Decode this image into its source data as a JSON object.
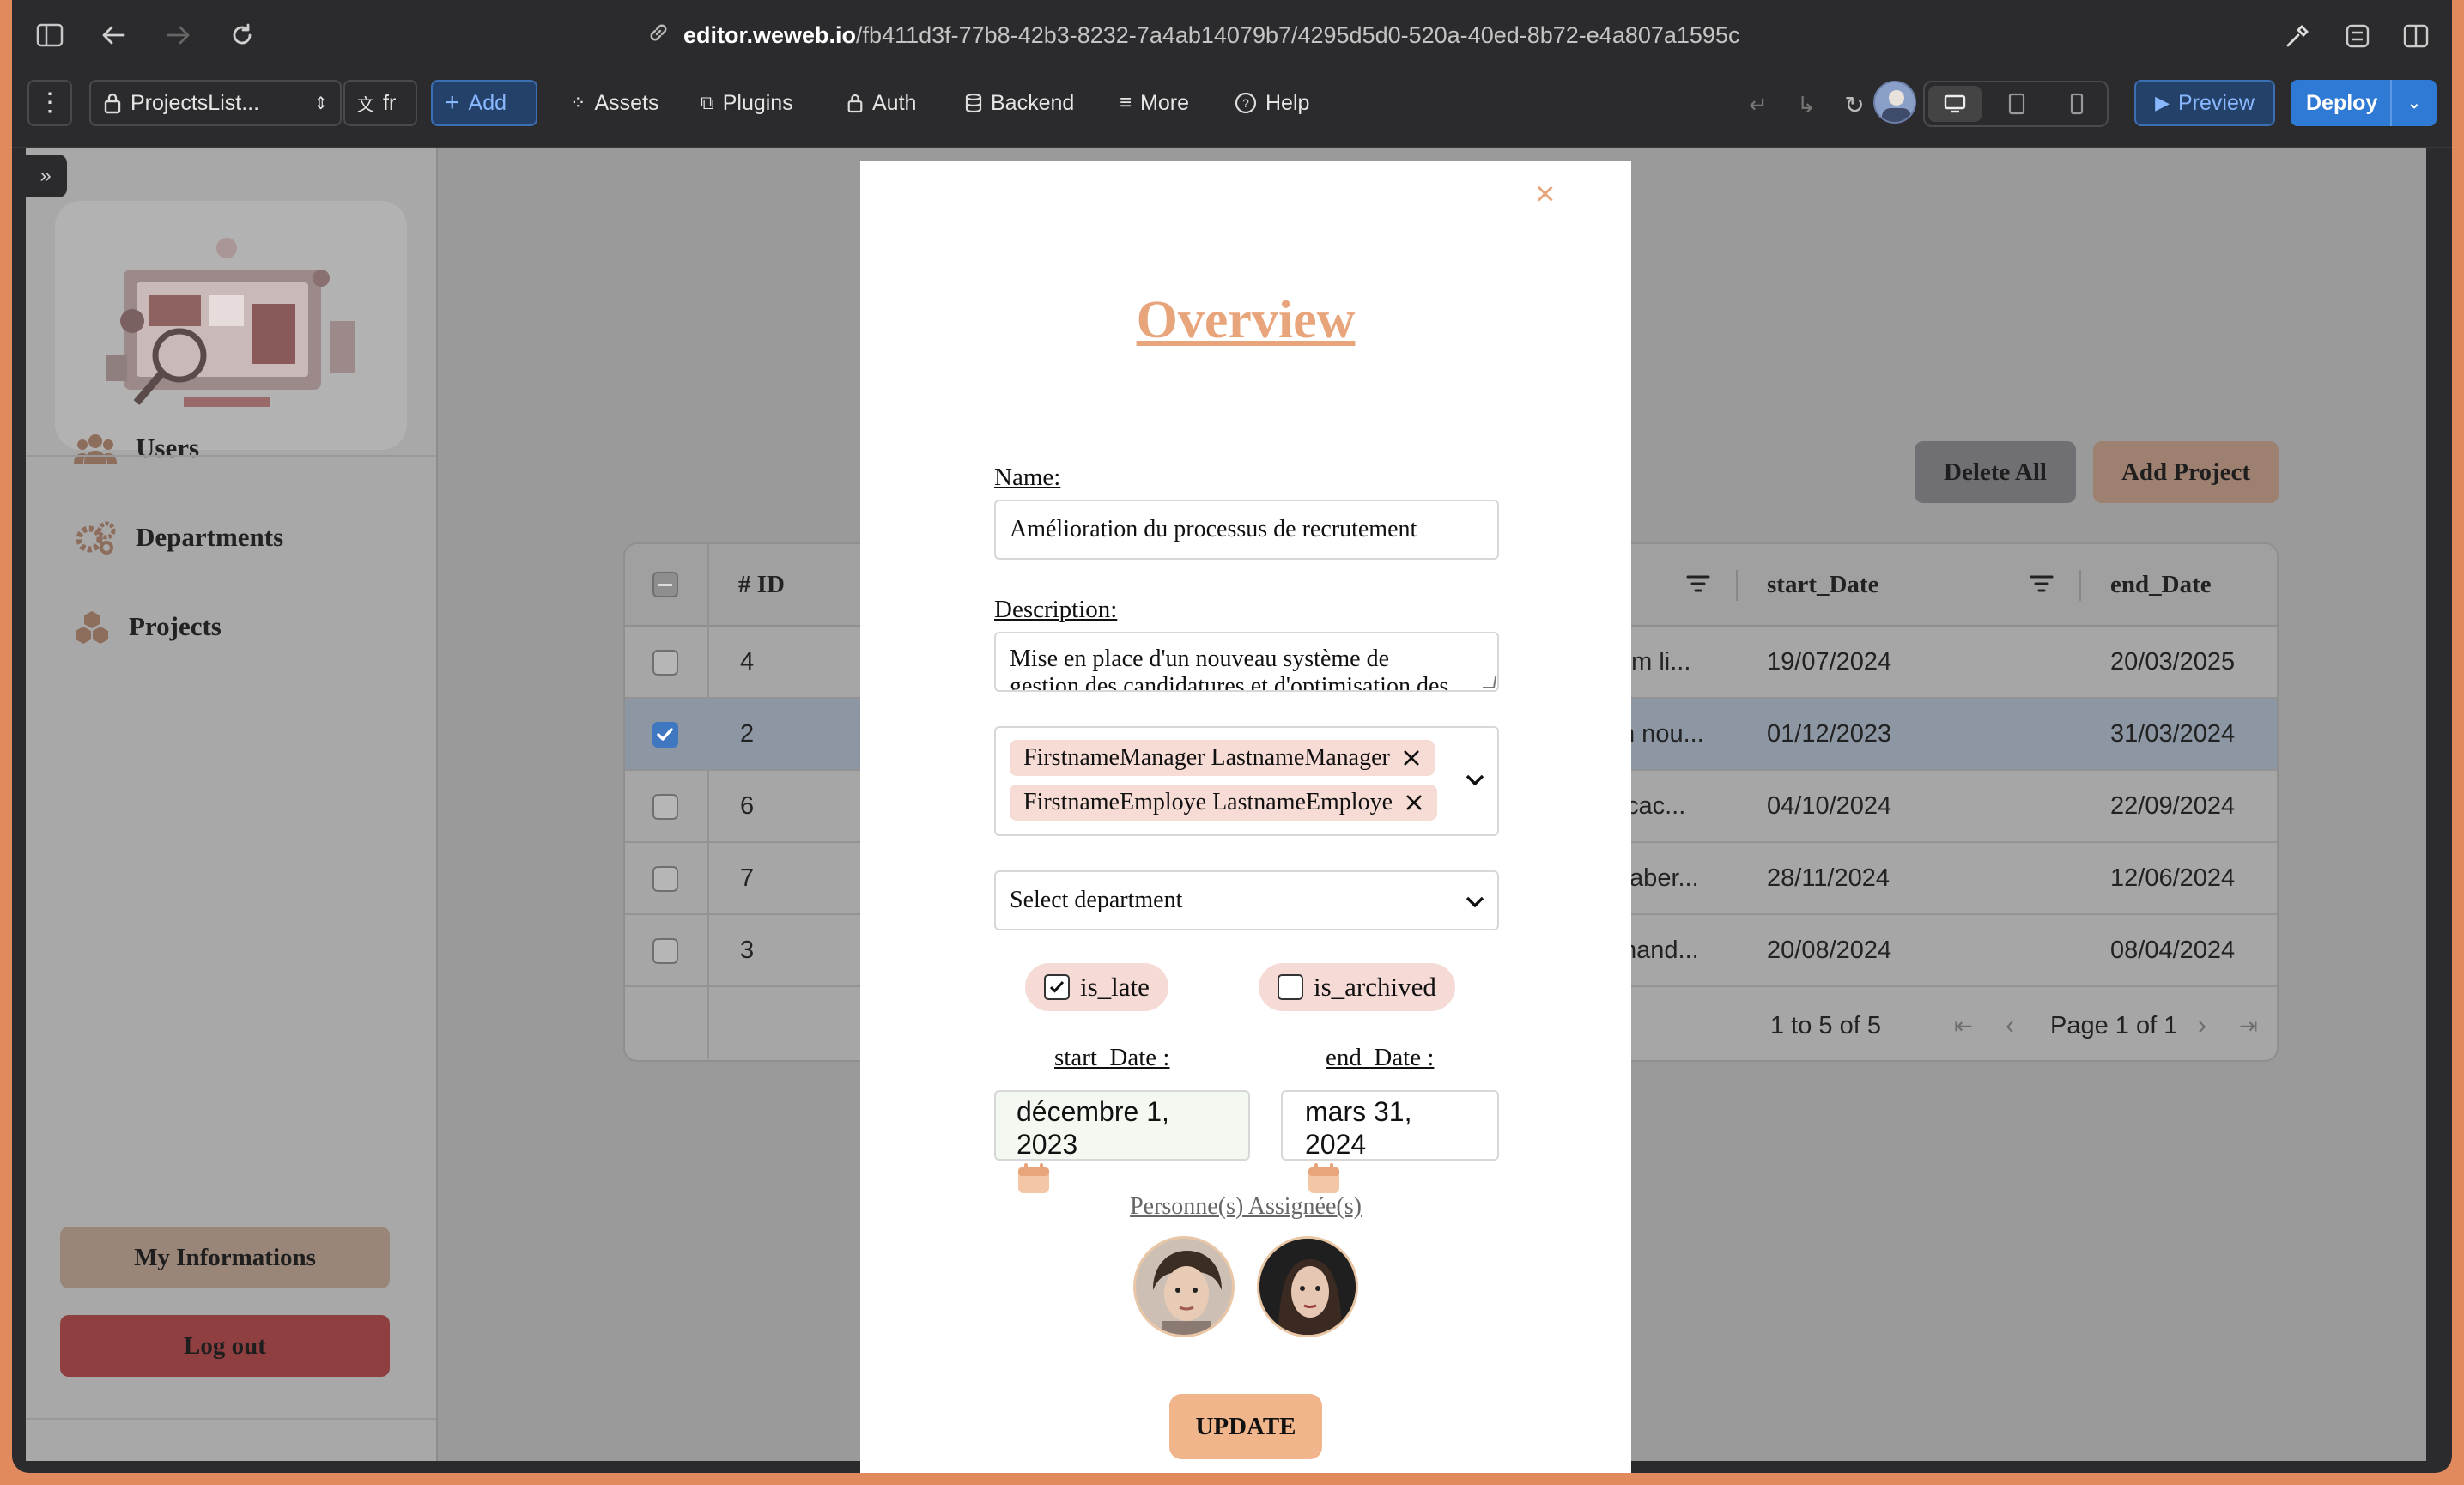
{
  "browser": {
    "url_host": "editor.weweb.io",
    "url_path": "/fb411d3f-77b8-42b3-8232-7a4ab14079b7/4295d5d0-520a-40ed-8b72-e4a807a1595c"
  },
  "toolbar": {
    "page_selector": "ProjectsList...",
    "lang": "fr",
    "add": "Add",
    "assets": "Assets",
    "plugins": "Plugins",
    "auth": "Auth",
    "backend": "Backend",
    "more": "More",
    "help": "Help",
    "preview": "Preview",
    "deploy": "Deploy"
  },
  "sidebar": {
    "items": [
      {
        "label": "Users",
        "icon": "users-icon"
      },
      {
        "label": "Departments",
        "icon": "gears-icon"
      },
      {
        "label": "Projects",
        "icon": "boxes-icon"
      }
    ],
    "my_info": "My Informations",
    "logout": "Log out"
  },
  "page": {
    "delete_all": "Delete All",
    "add_project": "Add Project",
    "table": {
      "headers": {
        "id": "# ID",
        "start": "start_Date",
        "end": "end_Date"
      },
      "rows": [
        {
          "id": "4",
          "desc": "um li...",
          "start": "19/07/2024",
          "end": "20/03/2025",
          "checked": false
        },
        {
          "id": "2",
          "desc": "n nou...",
          "start": "01/12/2023",
          "end": "31/03/2024",
          "checked": true
        },
        {
          "id": "6",
          "desc": "cac...",
          "start": "04/10/2024",
          "end": "22/09/2024",
          "checked": false
        },
        {
          "id": "7",
          "desc": "taber...",
          "start": "28/11/2024",
          "end": "12/06/2024",
          "checked": false
        },
        {
          "id": "3",
          "desc": "hand...",
          "start": "20/08/2024",
          "end": "08/04/2024",
          "checked": false
        }
      ],
      "pagination_count": "1 to 5 of 5",
      "pagination_page": "Page 1 of 1"
    }
  },
  "modal": {
    "close": "×",
    "title": "Overview",
    "name_label": "Name:",
    "name_value": "Amélioration du processus de recrutement",
    "description_label": "Description:",
    "description_line1": "Mise en place d'un nouveau système de",
    "description_line2": "gestion des candidatures et d'optimisation des",
    "assignees": [
      "FirstnameManager LastnameManager",
      "FirstnameEmploye LastnameEmploye"
    ],
    "department_placeholder": "Select department",
    "is_late": "is_late",
    "is_late_checked": true,
    "is_archived": "is_archived",
    "is_archived_checked": false,
    "start_label": "start_Date :",
    "end_label": "end_Date :",
    "start_value_line1": "décembre 1,",
    "start_value_line2": "2023",
    "end_value_line1": "mars 31,",
    "end_value_line2": "2024",
    "persons_label": "Personne(s) Assignée(s)",
    "update": "UPDATE"
  },
  "colors": {
    "accent": "#e8a57c",
    "danger": "#c94344",
    "deploy": "#2e7ad4"
  }
}
